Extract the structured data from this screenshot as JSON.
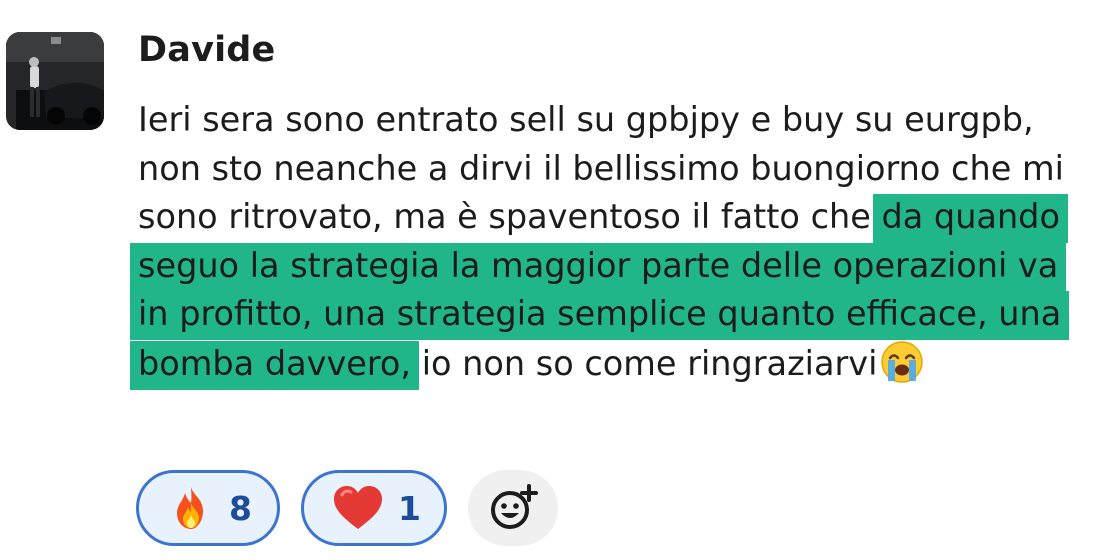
{
  "message": {
    "author": "Davide",
    "text_plain": "Ieri sera sono entrato sell su gpbjpy e buy su eurgpb, non sto neanche a dirvi il bellissimo buongiorno che mi sono ritrovato, ma è spaventoso il fatto che ",
    "text_highlight": "da quando seguo la strategia la maggior parte delle operazioni va in profitto, una strategia semplice quanto efficace, una bomba davvero,",
    "text_tail": " io non so come ringraziarvi",
    "trailing_emoji": "crying-face"
  },
  "reactions": [
    {
      "emoji": "fire",
      "count": "8"
    },
    {
      "emoji": "red-heart",
      "count": "1"
    }
  ],
  "colors": {
    "highlight": "#21b58a",
    "reaction_border": "#3d73d1",
    "reaction_bg": "#e8f2fc",
    "reaction_count": "#1d4c9a"
  }
}
